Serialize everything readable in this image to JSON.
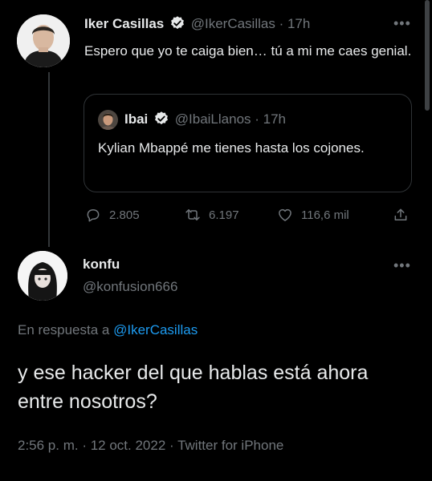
{
  "original_tweet": {
    "author_name": "Iker Casillas",
    "author_handle": "@IkerCasillas",
    "time": "· 17h",
    "text": "Espero que yo te caiga bien… tú a mi me caes genial.",
    "quote": {
      "author_name": "Ibai",
      "author_handle": "@IbaiLlanos",
      "time": "· 17h",
      "text": "Kylian Mbappé me tienes hasta los cojones."
    },
    "actions": {
      "replies": "2.805",
      "retweets": "6.197",
      "likes": "116,6 mil"
    }
  },
  "reply_tweet": {
    "author_name": "konfu",
    "author_handle": "@konfusion666",
    "reply_prefix": "En respuesta a",
    "reply_to": "@IkerCasillas",
    "text": "y ese hacker del que hablas está ahora entre nosotros?",
    "timestamp": "2:56 p. m. · 12 oct. 2022 · Twitter for iPhone"
  },
  "colors": {
    "background": "#000000",
    "accent": "#1d9bf0",
    "muted": "#71767b",
    "text": "#e7e9ea"
  },
  "icons": [
    "verified-badge-icon",
    "more-icon",
    "reply-icon",
    "retweet-icon",
    "like-icon",
    "share-icon"
  ]
}
